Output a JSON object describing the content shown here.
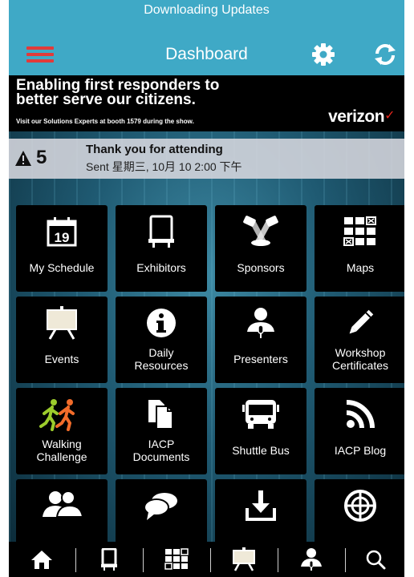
{
  "status_strip": {
    "text": "Downloading Updates"
  },
  "header": {
    "title": "Dashboard",
    "menu_icon": "hamburger-icon",
    "settings_icon": "gear-icon",
    "sync_icon": "sync-icon",
    "accent": "#3fa9c6",
    "menu_color": "#e23a3a"
  },
  "banner": {
    "headline": "Enabling first responders to better serve our citizens.",
    "subline": "Visit our Solutions Experts at booth 1579 during the show.",
    "brand": "verizon",
    "brand_mark": "✓"
  },
  "notice": {
    "count": "5",
    "title": "Thank you for attending",
    "subtitle": "Sent 星期三, 10月 10 2:00 下午"
  },
  "tiles": [
    {
      "label": "My Schedule",
      "icon": "calendar-icon"
    },
    {
      "label": "Exhibitors",
      "icon": "booth-icon"
    },
    {
      "label": "Sponsors",
      "icon": "spotlight-icon"
    },
    {
      "label": "Maps",
      "icon": "map-grid-icon"
    },
    {
      "label": "Events",
      "icon": "easel-icon"
    },
    {
      "label": "Daily\nResources",
      "icon": "info-icon"
    },
    {
      "label": "Presenters",
      "icon": "presenter-icon"
    },
    {
      "label": "Workshop\nCertificates",
      "icon": "pen-icon"
    },
    {
      "label": "Walking\nChallenge",
      "icon": "walkers-icon"
    },
    {
      "label": "IACP\nDocuments",
      "icon": "documents-icon"
    },
    {
      "label": "Shuttle Bus",
      "icon": "bus-icon"
    },
    {
      "label": "IACP Blog",
      "icon": "rss-icon"
    },
    {
      "label": "",
      "icon": "people-icon"
    },
    {
      "label": "",
      "icon": "chat-icon"
    },
    {
      "label": "",
      "icon": "download-icon"
    },
    {
      "label": "",
      "icon": "target-icon"
    }
  ],
  "tabbar": [
    {
      "icon": "home-icon"
    },
    {
      "icon": "booth-icon"
    },
    {
      "icon": "map-grid-icon"
    },
    {
      "icon": "easel-icon"
    },
    {
      "icon": "presenter-icon"
    },
    {
      "icon": "search-icon"
    }
  ]
}
